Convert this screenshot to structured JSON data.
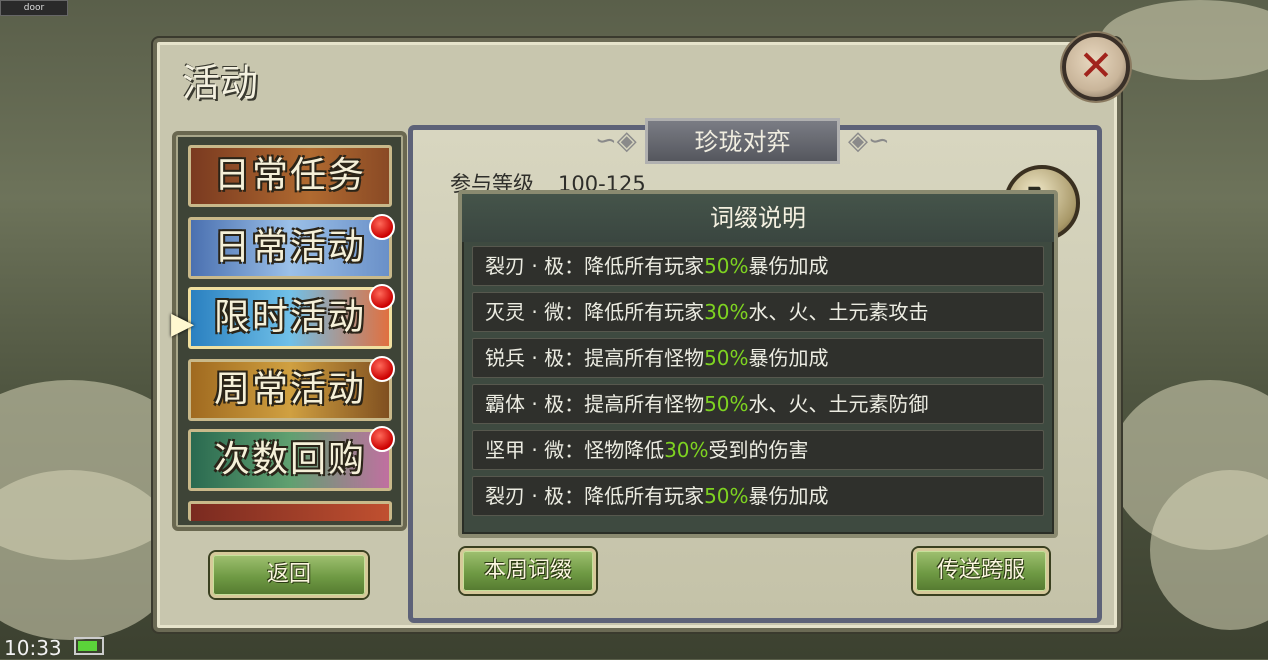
{
  "top_label": "door",
  "window": {
    "title": "活动",
    "close_icon": "✕"
  },
  "sidebar": {
    "items": [
      {
        "label": "日常任务",
        "badge": false
      },
      {
        "label": "日常活动",
        "badge": true
      },
      {
        "label": "限时活动",
        "badge": true,
        "selected": true
      },
      {
        "label": "周常活动",
        "badge": true
      },
      {
        "label": "次数回购",
        "badge": true
      }
    ],
    "back_label": "返回",
    "selected_marker": "▶"
  },
  "content": {
    "title": "珍珑对弈",
    "level_label": "参与等级",
    "level_value": "100-125",
    "refresh_icon": "↻",
    "weekly_affix_label": "本周词缀",
    "cross_server_label": "传送跨服"
  },
  "popup": {
    "title": "词缀说明",
    "rows": [
      {
        "pre": "裂刃 · 极：降低所有玩家",
        "pct": "50%",
        "post": "暴伤加成"
      },
      {
        "pre": "灭灵 · 微：降低所有玩家",
        "pct": "30%",
        "post": "水、火、土元素攻击"
      },
      {
        "pre": "锐兵 · 极：提高所有怪物",
        "pct": "50%",
        "post": "暴伤加成"
      },
      {
        "pre": "霸体 · 极：提高所有怪物",
        "pct": "50%",
        "post": "水、火、土元素防御"
      },
      {
        "pre": "坚甲 · 微：怪物降低",
        "pct": "30%",
        "post": "受到的伤害"
      },
      {
        "pre": "裂刃 · 极：降低所有玩家",
        "pct": "50%",
        "post": "暴伤加成"
      }
    ]
  },
  "status_bar": {
    "time": "10:33",
    "battery_level": 0.85
  },
  "colors": {
    "highlight": "#7ed321",
    "badge": "#d60000",
    "button_green": "#6f9a44"
  }
}
